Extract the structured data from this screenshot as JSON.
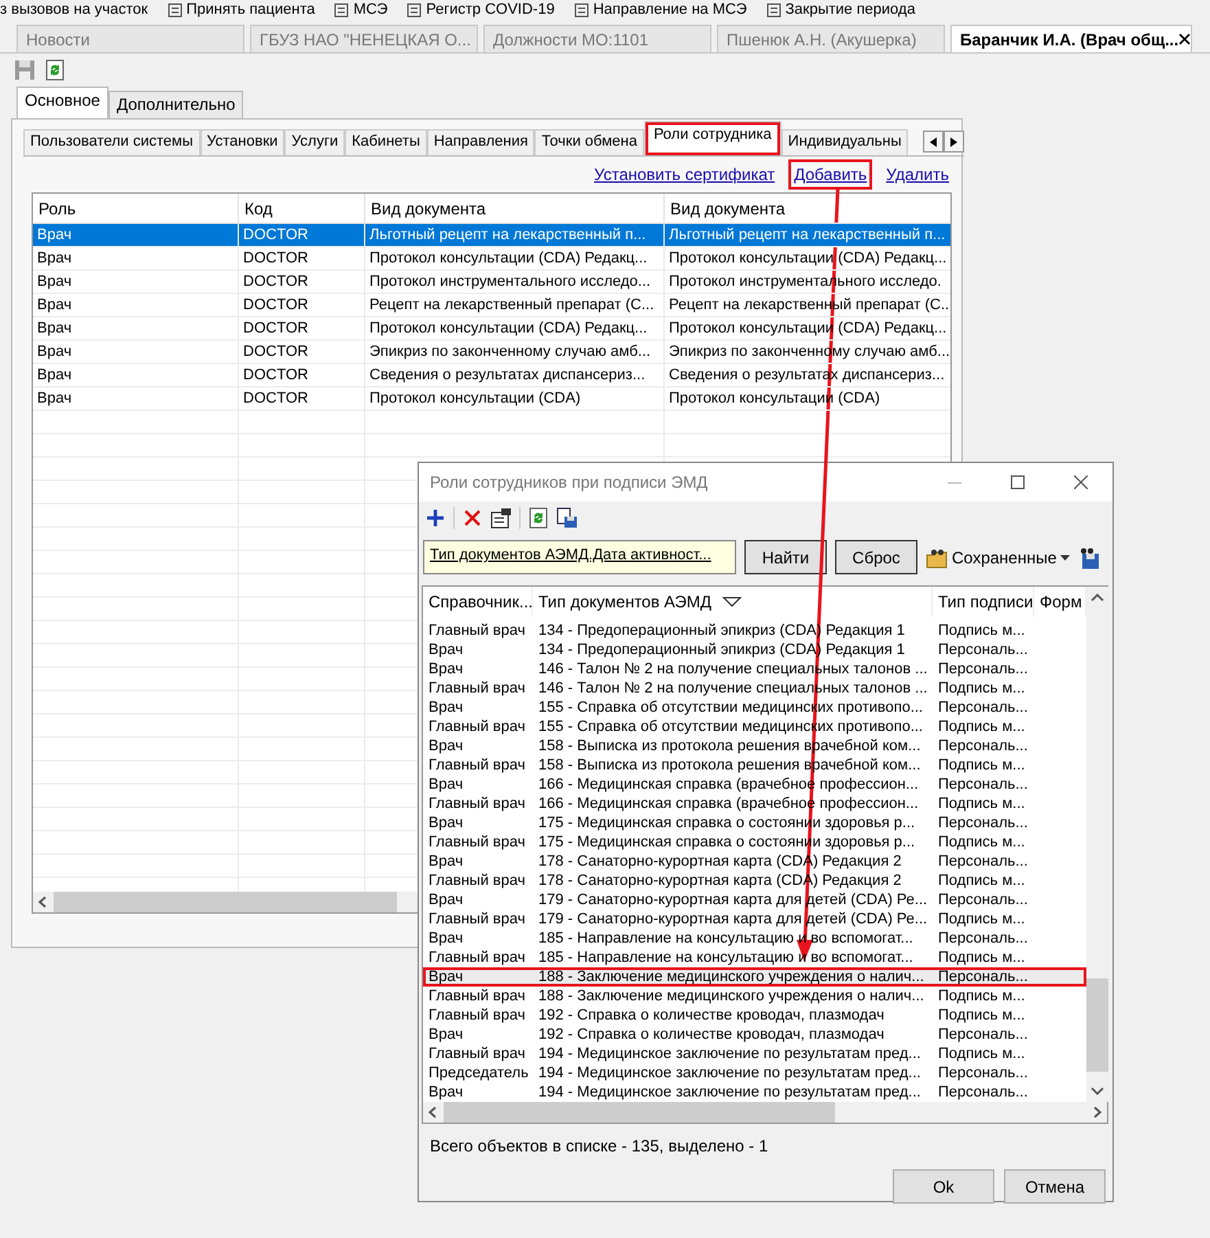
{
  "top_toolbar": {
    "items": [
      {
        "label": "з вызовов на участок"
      },
      {
        "label": "Принять пациента"
      },
      {
        "label": "МСЭ"
      },
      {
        "label": "Регистр COVID-19"
      },
      {
        "label": "Направление на МСЭ"
      },
      {
        "label": "Закрытие периода"
      }
    ]
  },
  "document_tabs": [
    {
      "label": "Новости",
      "selected": false
    },
    {
      "label": "ГБУЗ НАО \"НЕНЕЦКАЯ О...",
      "selected": false
    },
    {
      "label": "Должности МО:1101",
      "selected": false
    },
    {
      "label": "Пшенюк А.Н. (Акушерка)",
      "selected": false
    },
    {
      "label": "Баранчик И.А. (Врач общ...",
      "selected": true
    }
  ],
  "main_tabs": [
    {
      "label": "Основное",
      "selected": true
    },
    {
      "label": "Дополнительно",
      "selected": false
    }
  ],
  "sub_tabs": [
    {
      "label": "Пользователи системы",
      "selected": false,
      "highlighted": false
    },
    {
      "label": "Установки",
      "selected": false,
      "highlighted": false
    },
    {
      "label": "Услуги",
      "selected": false,
      "highlighted": false
    },
    {
      "label": "Кабинеты",
      "selected": false,
      "highlighted": false
    },
    {
      "label": "Направления",
      "selected": false,
      "highlighted": false
    },
    {
      "label": "Точки обмена",
      "selected": false,
      "highlighted": false
    },
    {
      "label": "Роли сотрудника",
      "selected": true,
      "highlighted": true
    },
    {
      "label": "Индивидуальны",
      "selected": false,
      "highlighted": false
    }
  ],
  "links": [
    {
      "label": "Установить сертификат",
      "highlighted": false
    },
    {
      "label": "Добавить",
      "highlighted": true
    },
    {
      "label": "Удалить",
      "highlighted": false
    }
  ],
  "table": {
    "columns": [
      "Роль",
      "Код",
      "Вид документа",
      "Вид документа"
    ],
    "rows": [
      {
        "cells": [
          "Врач",
          "DOCTOR",
          "Льготный рецепт на лекарственный п...",
          "Льготный рецепт на лекарственный п..."
        ],
        "selected": true
      },
      {
        "cells": [
          "Врач",
          "DOCTOR",
          "Протокол консультации (CDA) Редакц...",
          "Протокол консультации (CDA) Редакц..."
        ],
        "selected": false
      },
      {
        "cells": [
          "Врач",
          "DOCTOR",
          "Протокол инструментального исследо...",
          "Протокол инструментального исследо."
        ],
        "selected": false
      },
      {
        "cells": [
          "Врач",
          "DOCTOR",
          "Рецепт на лекарственный препарат (С...",
          "Рецепт на лекарственный препарат (С..."
        ],
        "selected": false
      },
      {
        "cells": [
          "Врач",
          "DOCTOR",
          "Протокол консультации (CDA) Редакц...",
          "Протокол консультации (CDA) Редакц..."
        ],
        "selected": false
      },
      {
        "cells": [
          "Врач",
          "DOCTOR",
          "Эпикриз по законченному случаю амб...",
          "Эпикриз по законченному случаю амб..."
        ],
        "selected": false
      },
      {
        "cells": [
          "Врач",
          "DOCTOR",
          "Сведения о результатах диспансериз...",
          "Сведения о результатах диспансериз..."
        ],
        "selected": false
      },
      {
        "cells": [
          "Врач",
          "DOCTOR",
          "Протокол консультации (CDA)",
          "Протокол консультации (CDA)"
        ],
        "selected": false
      }
    ]
  },
  "dialog": {
    "title": "Роли сотрудников при подписи ЭМД",
    "filter": {
      "value": "Тип документов АЭМД.Дата активност..."
    },
    "filter_buttons": [
      "Найти",
      "Сброс"
    ],
    "saved_menu": "Сохраненные",
    "table": {
      "columns": [
        "Справочник...",
        "Тип документов АЭМД",
        "Тип подписи",
        "Форм"
      ],
      "rows": [
        {
          "cells": [
            "Главный врач",
            "134 - Предоперационный эпикриз (CDA) Редакция 1",
            "Подпись м..."
          ],
          "selected": false,
          "highlighted": false
        },
        {
          "cells": [
            "Врач",
            "134 - Предоперационный эпикриз (CDA) Редакция 1",
            "Персональ..."
          ],
          "selected": false,
          "highlighted": false
        },
        {
          "cells": [
            "Врач",
            "146 - Талон № 2 на получение специальных талонов ...",
            "Персональ..."
          ],
          "selected": false,
          "highlighted": false
        },
        {
          "cells": [
            "Главный врач",
            "146 - Талон № 2 на получение специальных талонов ...",
            "Подпись м..."
          ],
          "selected": false,
          "highlighted": false
        },
        {
          "cells": [
            "Врач",
            "155 - Справка об отсутствии медицинских противопо...",
            "Персональ..."
          ],
          "selected": false,
          "highlighted": false
        },
        {
          "cells": [
            "Главный врач",
            "155 - Справка об отсутствии медицинских противопо...",
            "Подпись м..."
          ],
          "selected": false,
          "highlighted": false
        },
        {
          "cells": [
            "Врач",
            "158 - Выписка из протокола решения врачебной ком...",
            "Персональ..."
          ],
          "selected": false,
          "highlighted": false
        },
        {
          "cells": [
            "Главный врач",
            "158 - Выписка из протокола решения врачебной ком...",
            "Подпись м..."
          ],
          "selected": false,
          "highlighted": false
        },
        {
          "cells": [
            "Врач",
            "166 - Медицинская справка (врачебное профессион...",
            "Персональ..."
          ],
          "selected": false,
          "highlighted": false
        },
        {
          "cells": [
            "Главный врач",
            "166 - Медицинская справка (врачебное профессион...",
            "Подпись м..."
          ],
          "selected": false,
          "highlighted": false
        },
        {
          "cells": [
            "Врач",
            "175 - Медицинская справка о состоянии здоровья р...",
            "Персональ..."
          ],
          "selected": false,
          "highlighted": false
        },
        {
          "cells": [
            "Главный врач",
            "175 - Медицинская справка о состоянии здоровья р...",
            "Подпись м..."
          ],
          "selected": false,
          "highlighted": false
        },
        {
          "cells": [
            "Врач",
            "178 - Санаторно-курортная карта (CDA) Редакция 2",
            "Персональ..."
          ],
          "selected": false,
          "highlighted": false
        },
        {
          "cells": [
            "Главный врач",
            "178 - Санаторно-курортная карта (CDA) Редакция 2",
            "Подпись м..."
          ],
          "selected": false,
          "highlighted": false
        },
        {
          "cells": [
            "Врач",
            "179 - Санаторно-курортная карта для детей (CDA) Ре...",
            "Персональ..."
          ],
          "selected": false,
          "highlighted": false
        },
        {
          "cells": [
            "Главный врач",
            "179 - Санаторно-курортная карта для детей (CDA) Ре...",
            "Подпись м..."
          ],
          "selected": false,
          "highlighted": false
        },
        {
          "cells": [
            "Врач",
            "185 - Направление на консультацию и во вспомогат...",
            "Персональ..."
          ],
          "selected": false,
          "highlighted": false
        },
        {
          "cells": [
            "Главный врач",
            "185 - Направление на консультацию и во вспомогат...",
            "Подпись м..."
          ],
          "selected": false,
          "highlighted": false
        },
        {
          "cells": [
            "Врач",
            "188 - Заключение медицинского учреждения о налич...",
            "Персональ..."
          ],
          "selected": true,
          "highlighted": true
        },
        {
          "cells": [
            "Главный врач",
            "188 - Заключение медицинского учреждения о налич...",
            "Подпись м..."
          ],
          "selected": false,
          "highlighted": false
        },
        {
          "cells": [
            "Главный врач",
            "192 - Справка о количестве кроводач, плазмодач",
            "Подпись м..."
          ],
          "selected": false,
          "highlighted": false
        },
        {
          "cells": [
            "Врач",
            "192 - Справка о количестве кроводач, плазмодач",
            "Персональ..."
          ],
          "selected": false,
          "highlighted": false
        },
        {
          "cells": [
            "Главный врач",
            "194 - Медицинское заключение по результатам пред...",
            "Подпись м..."
          ],
          "selected": false,
          "highlighted": false
        },
        {
          "cells": [
            "Председатель",
            "194 - Медицинское заключение по результатам пред...",
            "Персональ..."
          ],
          "selected": false,
          "highlighted": false
        },
        {
          "cells": [
            "Врач",
            "194 - Медицинское заключение по результатам пред...",
            "Персональ..."
          ],
          "selected": false,
          "highlighted": false
        }
      ]
    },
    "status": "Всего объектов в списке - 135, выделено - 1",
    "buttons": [
      "Ok",
      "Отмена"
    ]
  }
}
